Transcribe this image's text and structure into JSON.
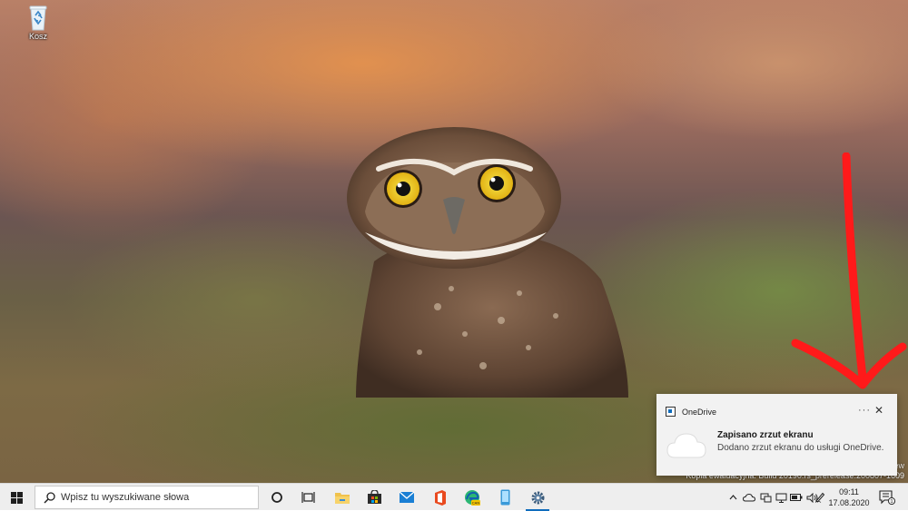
{
  "desktop": {
    "icons": [
      {
        "label": "Kosz",
        "icon": "recycle-bin-icon"
      }
    ],
    "watermark": {
      "edge": "ew",
      "text": "Kopia ewaluacyjna. Build 20190.rs_prerelease.200807-1609"
    },
    "annotation": {
      "type": "red-arrow",
      "color": "#ff1a1a"
    }
  },
  "toast": {
    "app_name": "OneDrive",
    "more": "···",
    "close": "✕",
    "title": "Zapisano zrzut ekranu",
    "body": "Dodano zrzut ekranu do usługi OneDrive.",
    "icon": "cloud-icon"
  },
  "taskbar": {
    "search_placeholder": "Wpisz tu wyszukiwane słowa",
    "pinned": [
      {
        "name": "cortana",
        "icon": "cortana-circle-icon"
      },
      {
        "name": "task-view",
        "icon": "task-view-icon"
      },
      {
        "name": "file-explorer",
        "icon": "folder-icon"
      },
      {
        "name": "microsoft-store",
        "icon": "store-bag-icon"
      },
      {
        "name": "mail",
        "icon": "mail-icon"
      },
      {
        "name": "office",
        "icon": "office-icon"
      },
      {
        "name": "edge-canary",
        "icon": "edge-canary-icon",
        "badge": "CAN"
      },
      {
        "name": "phone",
        "icon": "phone-icon"
      },
      {
        "name": "settings",
        "icon": "gear-icon",
        "active": true
      }
    ],
    "tray": {
      "icons": [
        "chevron-up-icon",
        "onedrive-cloud-icon",
        "network-icon",
        "display-icon",
        "battery-icon",
        "volume-icon",
        "pen-icon"
      ],
      "time": "09:11",
      "date": "17.08.2020",
      "notifications_badge": "1"
    }
  },
  "colors": {
    "accent": "#0f6cbd",
    "taskbar_bg": "#eeeeee",
    "toast_bg": "#f2f2f2",
    "arrow": "#ff1a1a"
  }
}
